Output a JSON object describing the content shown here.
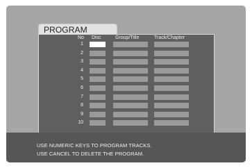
{
  "program": {
    "title": "PROGRAM",
    "columns": {
      "no": "No",
      "disc": "Disc",
      "group_title": "Group/Title",
      "track_chapter": "Track/Chapter"
    },
    "rows": [
      {
        "no": "1",
        "selected": true
      },
      {
        "no": "2"
      },
      {
        "no": "3"
      },
      {
        "no": "4"
      },
      {
        "no": "5"
      },
      {
        "no": "6"
      },
      {
        "no": "7"
      },
      {
        "no": "8"
      },
      {
        "no": "9"
      },
      {
        "no": "10"
      }
    ]
  },
  "help": {
    "line1": "USE NUMERIC KEYS TO PROGRAM TRACKS.",
    "line2": "USE CANCEL TO DELETE THE PROGRAM."
  },
  "colors": {
    "screen_bg": "#a6a6a6",
    "panel_bg": "#5f5f5f",
    "cell_bg": "#9a9a9a",
    "selected_cell": "#ffffff",
    "help_bar": "#565656"
  }
}
